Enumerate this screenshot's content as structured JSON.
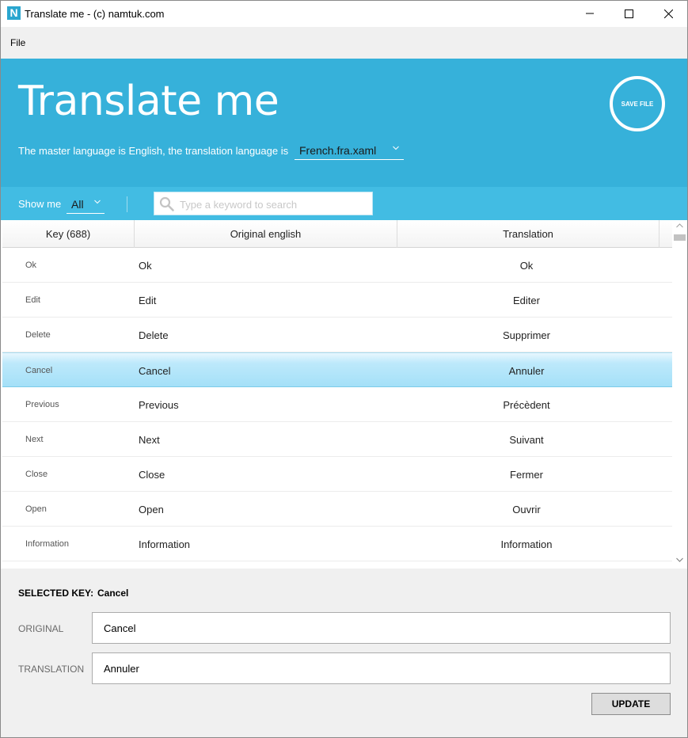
{
  "window": {
    "icon_letter": "N",
    "title": "Translate me - (c) namtuk.com"
  },
  "menu": {
    "file": "File"
  },
  "header": {
    "title": "Translate me",
    "language_text": "The master language is English, the translation language is",
    "language_selected": "French.fra.xaml",
    "save_label": "SAVE FILE"
  },
  "filter": {
    "show_label": "Show me",
    "show_selected": "All",
    "search_placeholder": "Type a keyword to search",
    "search_value": ""
  },
  "table": {
    "columns": {
      "key": "Key (688)",
      "original": "Original english",
      "translation": "Translation"
    },
    "rows": [
      {
        "key": "Ok",
        "original": "Ok",
        "translation": "Ok"
      },
      {
        "key": "Edit",
        "original": "Edit",
        "translation": "Editer"
      },
      {
        "key": "Delete",
        "original": "Delete",
        "translation": "Supprimer"
      },
      {
        "key": "Cancel",
        "original": "Cancel",
        "translation": "Annuler"
      },
      {
        "key": "Previous",
        "original": "Previous",
        "translation": "Précèdent"
      },
      {
        "key": "Next",
        "original": "Next",
        "translation": "Suivant"
      },
      {
        "key": "Close",
        "original": "Close",
        "translation": "Fermer"
      },
      {
        "key": "Open",
        "original": "Open",
        "translation": "Ouvrir"
      },
      {
        "key": "Information",
        "original": "Information",
        "translation": "Information"
      }
    ],
    "selected_index": 3
  },
  "editor": {
    "selected_key_label": "SELECTED KEY:",
    "selected_key_value": "Cancel",
    "original_label": "ORIGINAL",
    "original_value": "Cancel",
    "translation_label": "TRANSLATION",
    "translation_value": "Annuler",
    "update_label": "UPDATE"
  },
  "colors": {
    "header_bg": "#36b1da",
    "filterbar_bg": "#42bce3",
    "selected_row": "#a4e0f8"
  }
}
